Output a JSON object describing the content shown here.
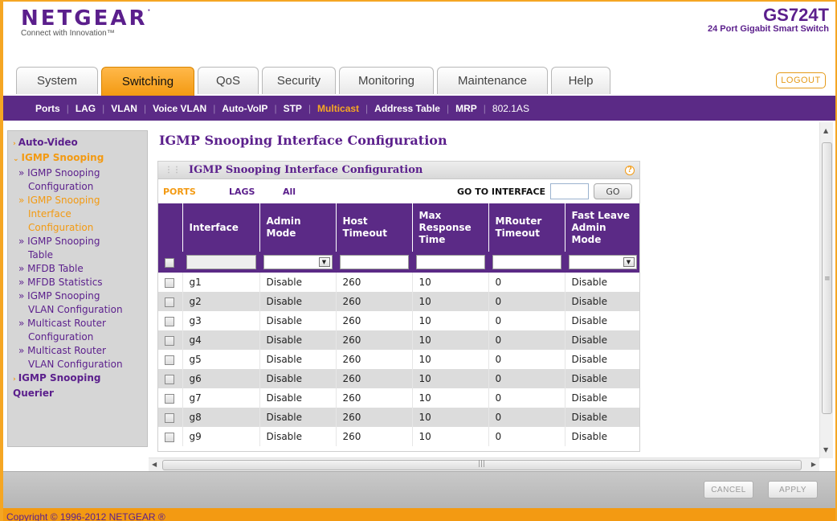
{
  "brand": {
    "logo": "NETGEAR",
    "tagline": "Connect with Innovation™"
  },
  "device": {
    "model": "GS724T",
    "description": "24 Port Gigabit Smart Switch"
  },
  "tabs": [
    {
      "label": "System"
    },
    {
      "label": "Switching"
    },
    {
      "label": "QoS"
    },
    {
      "label": "Security"
    },
    {
      "label": "Monitoring"
    },
    {
      "label": "Maintenance"
    },
    {
      "label": "Help"
    }
  ],
  "active_tab": "Switching",
  "logout_label": "LOGOUT",
  "subnav": [
    {
      "label": "Ports"
    },
    {
      "label": "LAG"
    },
    {
      "label": "VLAN"
    },
    {
      "label": "Voice VLAN"
    },
    {
      "label": "Auto-VoIP"
    },
    {
      "label": "STP"
    },
    {
      "label": "Multicast"
    },
    {
      "label": "Address Table"
    },
    {
      "label": "MRP"
    },
    {
      "label": "802.1AS"
    }
  ],
  "active_subnav": "Multicast",
  "sidebar": {
    "auto_video": "Auto-Video",
    "igmp_snooping": "IGMP Snooping",
    "items": [
      {
        "label1": "» IGMP Snooping",
        "label2": "Configuration"
      },
      {
        "label1": "» IGMP Snooping",
        "label2": "Interface",
        "label3": "Configuration"
      },
      {
        "label1": "» IGMP Snooping",
        "label2": "Table"
      },
      {
        "label1": "» MFDB Table"
      },
      {
        "label1": "» MFDB Statistics"
      },
      {
        "label1": "» IGMP Snooping",
        "label2": "VLAN Configuration"
      },
      {
        "label1": "» Multicast Router",
        "label2": "Configuration"
      },
      {
        "label1": "» Multicast Router",
        "label2": "VLAN Configuration"
      }
    ],
    "querier1": "IGMP Snooping",
    "querier2": "Querier"
  },
  "page_title": "IGMP Snooping Interface Configuration",
  "panel": {
    "title": "IGMP Snooping Interface Configuration",
    "filter_ports": "PORTS",
    "filter_lags": "LAGS",
    "filter_all": "All",
    "goto_label": "GO TO INTERFACE",
    "goto_value": "",
    "go_label": "GO"
  },
  "table": {
    "headers": {
      "interface": "Interface",
      "admin1": "Admin",
      "admin2": "Mode",
      "host1": "Host",
      "host2": "Timeout",
      "max1": "Max",
      "max2": "Response",
      "max3": "Time",
      "mrouter1": "MRouter",
      "mrouter2": "Timeout",
      "fast1": "Fast Leave",
      "fast2": "Admin",
      "fast3": "Mode"
    },
    "rows": [
      {
        "iface": "g1",
        "admin": "Disable",
        "host": "260",
        "max": "10",
        "mrouter": "0",
        "fast": "Disable"
      },
      {
        "iface": "g2",
        "admin": "Disable",
        "host": "260",
        "max": "10",
        "mrouter": "0",
        "fast": "Disable"
      },
      {
        "iface": "g3",
        "admin": "Disable",
        "host": "260",
        "max": "10",
        "mrouter": "0",
        "fast": "Disable"
      },
      {
        "iface": "g4",
        "admin": "Disable",
        "host": "260",
        "max": "10",
        "mrouter": "0",
        "fast": "Disable"
      },
      {
        "iface": "g5",
        "admin": "Disable",
        "host": "260",
        "max": "10",
        "mrouter": "0",
        "fast": "Disable"
      },
      {
        "iface": "g6",
        "admin": "Disable",
        "host": "260",
        "max": "10",
        "mrouter": "0",
        "fast": "Disable"
      },
      {
        "iface": "g7",
        "admin": "Disable",
        "host": "260",
        "max": "10",
        "mrouter": "0",
        "fast": "Disable"
      },
      {
        "iface": "g8",
        "admin": "Disable",
        "host": "260",
        "max": "10",
        "mrouter": "0",
        "fast": "Disable"
      },
      {
        "iface": "g9",
        "admin": "Disable",
        "host": "260",
        "max": "10",
        "mrouter": "0",
        "fast": "Disable"
      }
    ]
  },
  "buttons": {
    "cancel": "CANCEL",
    "apply": "APPLY"
  },
  "footer": "Copyright © 1996-2012 NETGEAR ®",
  "colors": {
    "brand_purple": "#5b2a86",
    "accent_orange": "#f39a12"
  }
}
